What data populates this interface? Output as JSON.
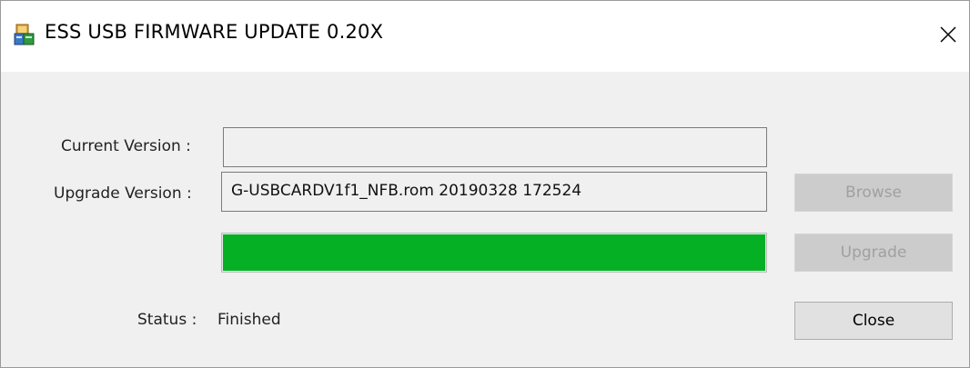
{
  "window": {
    "title": "ESS USB FIRMWARE UPDATE 0.20X",
    "icon": "firmware-app-icon",
    "close_icon": "close-icon"
  },
  "form": {
    "current_version_label": "Current Version :",
    "current_version_value": "",
    "upgrade_version_label": "Upgrade Version :",
    "upgrade_version_value": "G-USBCARDV1f1_NFB.rom 20190328 172524",
    "progress_fraction": 1.0,
    "status_label": "Status :",
    "status_value": "Finished"
  },
  "buttons": {
    "browse": {
      "label": "Browse",
      "enabled": false
    },
    "upgrade": {
      "label": "Upgrade",
      "enabled": false
    },
    "close": {
      "label": "Close",
      "enabled": true
    }
  },
  "colors": {
    "progress_fill": "#06b025",
    "window_bg": "#f0f0f0",
    "titlebar_bg": "#ffffff"
  }
}
